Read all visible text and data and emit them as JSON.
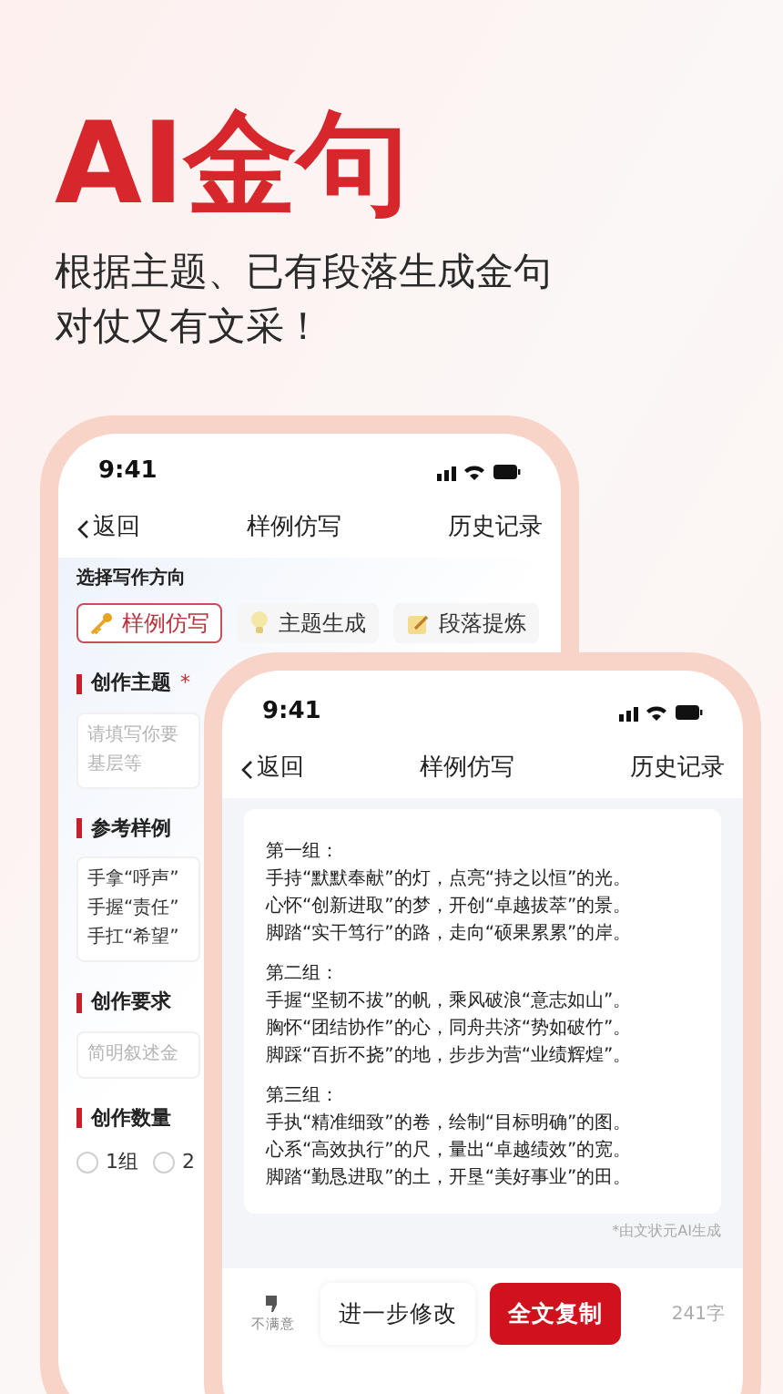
{
  "headline": {
    "title": "AI金句",
    "subtitle_lines": [
      "根据主题、已有段落生成金句",
      "对仗又有文采！"
    ]
  },
  "back_phone": {
    "time": "9:41",
    "nav": {
      "back": "返回",
      "title": "样例仿写",
      "action": "历史记录"
    },
    "direction_label": "选择写作方向",
    "chips": [
      {
        "label": "样例仿写",
        "selected": true
      },
      {
        "label": "主题生成",
        "selected": false
      },
      {
        "label": "段落提炼",
        "selected": false
      }
    ],
    "fields": [
      {
        "label": "创作主题",
        "required_mark": "*",
        "placeholder_lines": [
          "请填写你要",
          "基层等"
        ]
      },
      {
        "label": "参考样例",
        "value_lines": [
          "手拿“呼声”",
          "手握“责任”",
          "手扛“希望”"
        ]
      },
      {
        "label": "创作要求",
        "placeholder_lines": [
          "简明叙述金"
        ]
      }
    ],
    "count": {
      "label": "创作数量",
      "options": [
        {
          "label": "1组",
          "selected": false
        },
        {
          "label": "2",
          "selected": false
        }
      ]
    }
  },
  "front_phone": {
    "time": "9:41",
    "nav": {
      "back": "返回",
      "title": "样例仿写",
      "action": "历史记录"
    },
    "groups": [
      {
        "title": "第一组：",
        "lines": [
          "手持“默默奉献”的灯，点亮“持之以恒”的光。",
          "心怀“创新进取”的梦，开创“卓越拔萃”的景。",
          "脚踏“实干笃行”的路，走向“硕果累累”的岸。"
        ]
      },
      {
        "title": "第二组：",
        "lines": [
          "手握“坚韧不拔”的帆，乘风破浪“意志如山”。",
          "胸怀“团结协作”的心，同舟共济“势如破竹”。",
          "脚踩“百折不挠”的地，步步为营“业绩辉煌”。"
        ]
      },
      {
        "title": "第三组：",
        "lines": [
          "手执“精准细致”的卷，绘制“目标明确”的图。",
          "心系“高效执行”的尺，量出“卓越绩效”的宽。",
          "脚踏“勤恳进取”的土，开垦“美好事业”的田。"
        ]
      }
    ],
    "footnote": "*由文状元AI生成",
    "bottom": {
      "dislike": "不满意",
      "revise": "进一步修改",
      "copy": "全文复制",
      "count": "241字"
    }
  }
}
